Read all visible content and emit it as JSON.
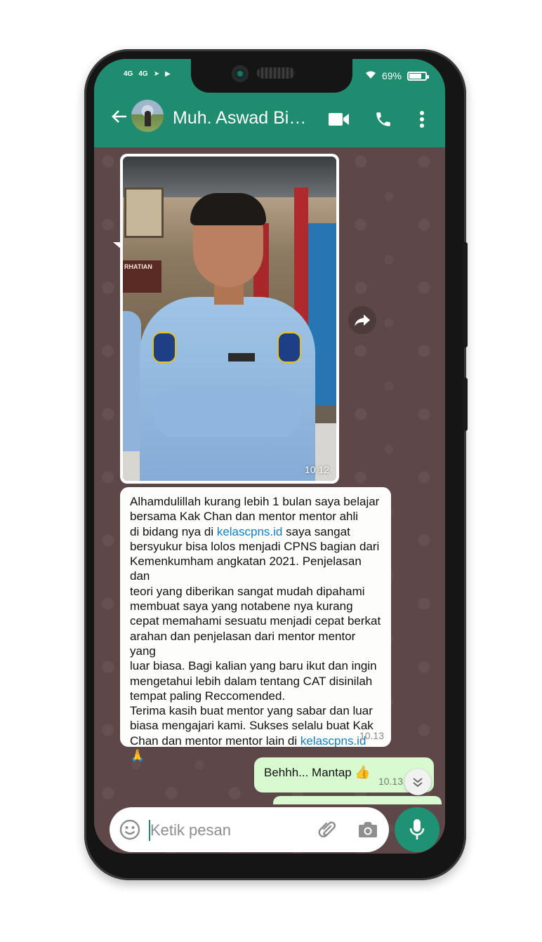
{
  "status_bar": {
    "signal_1": "4G",
    "signal_2": "4G",
    "battery": "69%"
  },
  "header": {
    "contact_name": "Muh. Aswad Bim...",
    "icons": [
      "back-arrow-icon",
      "video-call-icon",
      "phone-call-icon",
      "more-vertical-icon"
    ]
  },
  "photo_message": {
    "sign_text": "RHATIAN",
    "time": "10.12"
  },
  "text_message": {
    "part1": "Alhamdulillah kurang lebih 1 bulan saya belajar\nbersama Kak Chan dan mentor mentor ahli\ndi bidang nya di ",
    "link1": "kelascpns.id",
    "part2": " saya sangat\nbersyukur bisa lolos menjadi CPNS bagian dari\nKemenkumham angkatan 2021. Penjelasan dan\nteori yang diberikan sangat mudah dipahami\nmembuat saya yang notabene nya kurang\ncepat memahami sesuatu menjadi cepat berkat\narahan dan penjelasan dari mentor mentor yang\nluar biasa. Bagi kalian yang baru ikut dan ingin\nmengetahui lebih dalam tentang CAT disinilah\ntempat paling Reccomended.\nTerima kasih buat mentor yang sabar dan luar\nbiasa mengajari kami. Sukses selalu buat Kak\nChan dan mentor mentor lain di ",
    "link2": "kelascpns.id",
    "emoji": "🙏",
    "time": "10.13"
  },
  "outgoing_message": {
    "text": "Behhh... Mantap",
    "emoji": "👍",
    "time": "10.13"
  },
  "input": {
    "placeholder": "Ketik pesan"
  },
  "colors": {
    "header_green": "#1f8c6f",
    "chat_background": "#5e4749",
    "outgoing_bubble": "#d8fad0",
    "link_blue": "#127ec0"
  }
}
